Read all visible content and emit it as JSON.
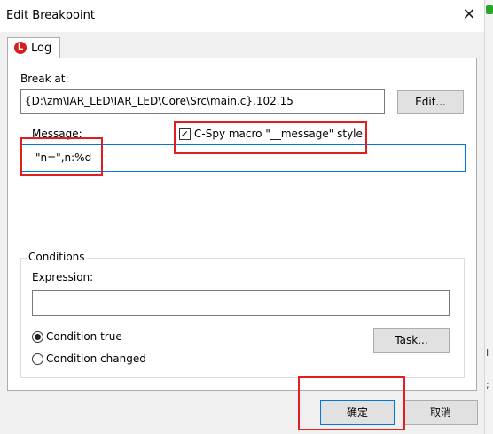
{
  "window": {
    "title": "Edit Breakpoint",
    "close_glyph": "✕"
  },
  "tab": {
    "icon_letter": "L",
    "label": "Log"
  },
  "break_at": {
    "label": "Break at:",
    "value": "{D:\\zm\\IAR_LED\\IAR_LED\\Core\\Src\\main.c}.102.15",
    "edit_button": "Edit..."
  },
  "message": {
    "label": "Message:",
    "value": "\"n=\",n:%d"
  },
  "cspy_style": {
    "checked": true,
    "check_glyph": "✓",
    "label": "C-Spy macro \"__message\" style"
  },
  "conditions": {
    "title": "Conditions",
    "expression_label": "Expression:",
    "expression_value": "",
    "condition_true": "Condition true",
    "condition_changed": "Condition changed",
    "selected": "condition_true",
    "task_button": "Task..."
  },
  "footer": {
    "ok_button": "确定",
    "cancel_button": "取消"
  },
  "background_window": {
    "edge_text_1": "I",
    "edge_text_2": ";"
  },
  "colors": {
    "highlight": "#e02020",
    "accent": "#0078d7",
    "tab_icon": "#d22020"
  }
}
